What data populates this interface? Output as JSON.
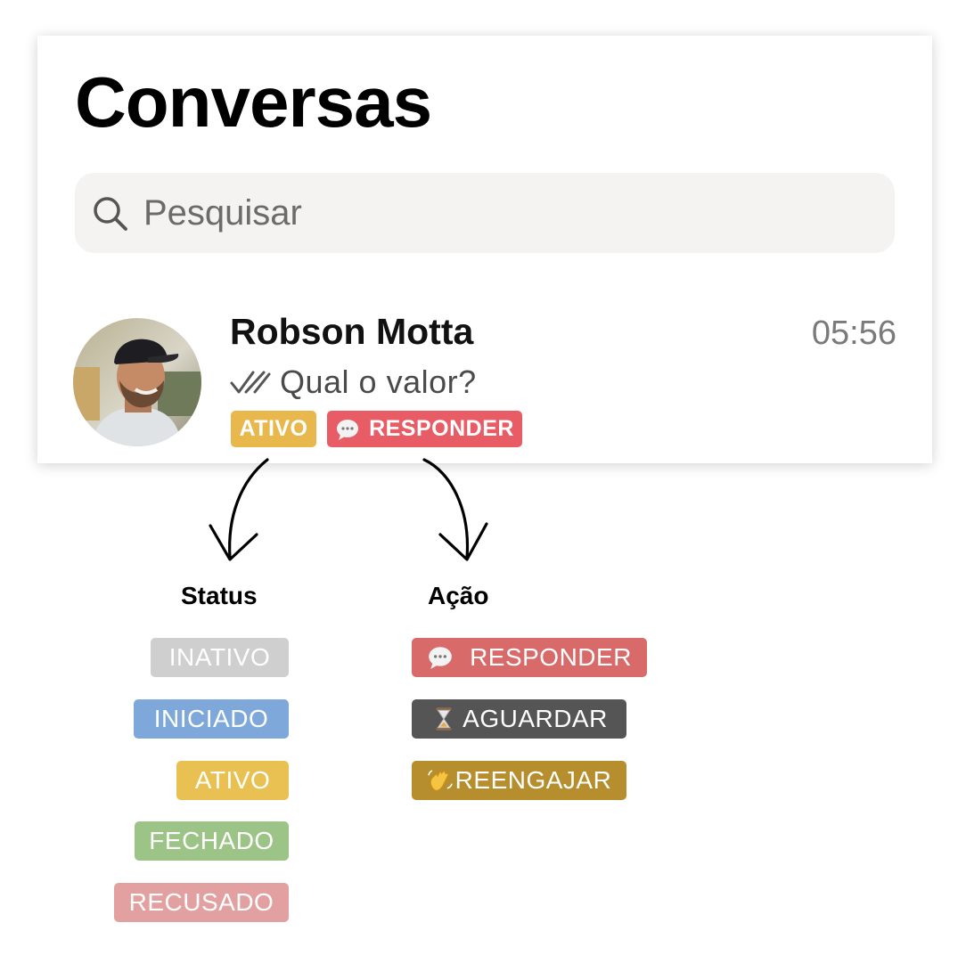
{
  "header": {
    "title": "Conversas"
  },
  "search": {
    "placeholder": "Pesquisar",
    "icon": "search-icon"
  },
  "conversation": {
    "name": "Robson Motta",
    "time": "05:56",
    "preview": "Qual o valor?",
    "read_icon": "double-check-icon",
    "status_tag": {
      "label": "ATIVO",
      "color": "#e8b84c"
    },
    "action_tag": {
      "label": "RESPONDER",
      "icon": "speech-bubble-icon",
      "color": "#e85c66"
    }
  },
  "legend": {
    "status_heading": "Status",
    "action_heading": "Ação",
    "statuses": [
      {
        "label": "INATIVO",
        "color": "#cfcfcf"
      },
      {
        "label": "INICIADO",
        "color": "#7fa8da"
      },
      {
        "label": "ATIVO",
        "color": "#e8c152"
      },
      {
        "label": "FECHADO",
        "color": "#9cc487"
      },
      {
        "label": "RECUSADO",
        "color": "#e3a0a0"
      }
    ],
    "actions": [
      {
        "label": "RESPONDER",
        "icon": "speech-bubble-icon",
        "color": "#d96a6a"
      },
      {
        "label": "AGUARDAR",
        "icon": "hourglass-icon",
        "color": "#555555"
      },
      {
        "label": "REENGAJAR",
        "icon": "waving-hand-icon",
        "color": "#b68e2e"
      }
    ]
  }
}
